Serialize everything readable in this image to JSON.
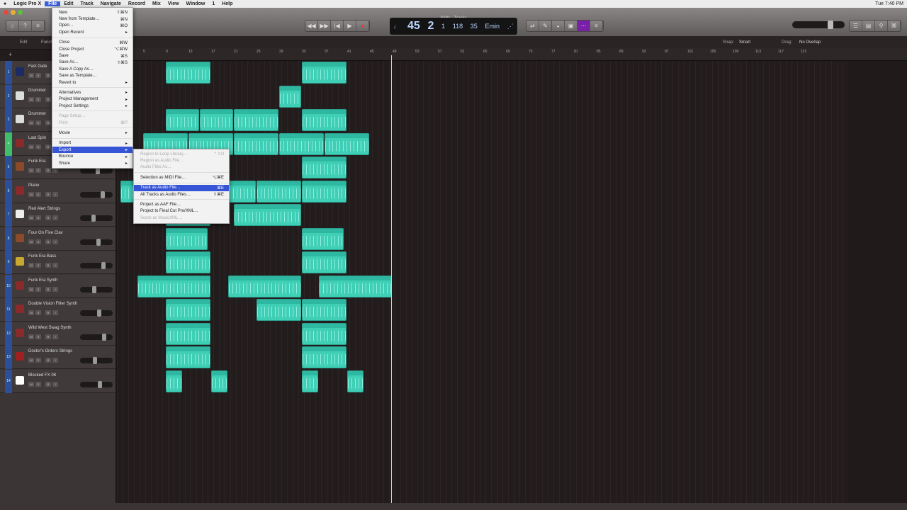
{
  "menubar": {
    "apple": "",
    "app": "Logic Pro X",
    "items": [
      "File",
      "Edit",
      "Track",
      "Navigate",
      "Record",
      "Mix",
      "View",
      "Window",
      "1",
      "Help"
    ],
    "clock": "Tue 7:40 PM"
  },
  "window": {
    "title": "Skills - Tracks"
  },
  "lcd": {
    "bar": "45",
    "beat": "2",
    "div": "1",
    "tempo": "118",
    "sig": "35",
    "key": "Emin"
  },
  "sub": {
    "edit": "Edit",
    "functions": "Functions",
    "snap_label": "Snap:",
    "snap": "Smart",
    "drag_label": "Drag:",
    "drag": "No Overlap"
  },
  "ruler": [
    "1",
    "5",
    "9",
    "13",
    "17",
    "21",
    "25",
    "29",
    "33",
    "37",
    "41",
    "45",
    "49",
    "53",
    "57",
    "61",
    "65",
    "69",
    "73",
    "77",
    "81",
    "85",
    "89",
    "93",
    "97",
    "101",
    "105",
    "109",
    "113",
    "117",
    "121"
  ],
  "tracks": [
    {
      "num": "1",
      "name": "Fast Gate",
      "color": "#1c2b66"
    },
    {
      "num": "2",
      "name": "Drummer",
      "color": "#ddd"
    },
    {
      "num": "3",
      "name": "Drummer",
      "color": "#ddd"
    },
    {
      "num": "4",
      "name": "Last Spin",
      "color": "#8b2a2a"
    },
    {
      "num": "5",
      "name": "Funk Era",
      "color": "#8b4a2a"
    },
    {
      "num": "6",
      "name": "Piano",
      "color": "#8b2a2a"
    },
    {
      "num": "7",
      "name": "Red Alert Strings",
      "color": "#eee"
    },
    {
      "num": "8",
      "name": "Four On Five Clav",
      "color": "#8b4a2a"
    },
    {
      "num": "9",
      "name": "Funk Era Bass",
      "color": "#c8a830"
    },
    {
      "num": "10",
      "name": "Funk Era Synth",
      "color": "#8b2a2a"
    },
    {
      "num": "11",
      "name": "Double Vision Filter Synth",
      "color": "#8b2a2a"
    },
    {
      "num": "12",
      "name": "Wild West Swag Synth",
      "color": "#8b2a2a"
    },
    {
      "num": "13",
      "name": "Doctor's Orders Strings",
      "color": "#a02020"
    },
    {
      "num": "14",
      "name": "Blocked FX 08",
      "color": "#fff"
    }
  ],
  "track_buttons": [
    "M",
    "S",
    "R",
    "I"
  ],
  "regions": [
    [
      [
        8,
        16
      ],
      [
        32,
        40
      ]
    ],
    [
      [
        28,
        32
      ]
    ],
    [
      [
        8,
        14
      ],
      [
        14,
        20
      ],
      [
        20,
        28
      ],
      [
        32,
        40
      ]
    ],
    [
      [
        4,
        12
      ],
      [
        12,
        20
      ],
      [
        20,
        28
      ],
      [
        28,
        36
      ],
      [
        36,
        44
      ]
    ],
    [
      [
        32,
        40
      ]
    ],
    [
      [
        0,
        8
      ],
      [
        8,
        16
      ],
      [
        16,
        24
      ],
      [
        24,
        32
      ],
      [
        32,
        40
      ]
    ],
    [
      [
        8,
        16
      ],
      [
        20,
        32
      ]
    ],
    [
      [
        8,
        15.5
      ],
      [
        32,
        39.5
      ]
    ],
    [
      [
        8,
        16
      ],
      [
        32,
        40
      ]
    ],
    [
      [
        3,
        16
      ],
      [
        19,
        32
      ],
      [
        35,
        48
      ]
    ],
    [
      [
        8,
        16
      ],
      [
        24,
        32
      ],
      [
        32,
        40
      ]
    ],
    [
      [
        8,
        16
      ],
      [
        32,
        40
      ]
    ],
    [
      [
        8,
        16
      ],
      [
        32,
        40
      ]
    ],
    [
      [
        8,
        11
      ],
      [
        16,
        19
      ],
      [
        32,
        35
      ],
      [
        40,
        43
      ]
    ]
  ],
  "playhead_bar": 48,
  "file_menu": [
    {
      "label": "New",
      "key": "⇧⌘N"
    },
    {
      "label": "New from Template…",
      "key": "⌘N"
    },
    {
      "label": "Open…",
      "key": "⌘O"
    },
    {
      "label": "Open Recent",
      "key": "▸"
    },
    {
      "sep": true
    },
    {
      "label": "Close",
      "key": "⌘W"
    },
    {
      "label": "Close Project",
      "key": "⌥⌘W"
    },
    {
      "label": "Save",
      "key": "⌘S"
    },
    {
      "label": "Save As…",
      "key": "⇧⌘S"
    },
    {
      "label": "Save A Copy As…",
      "key": ""
    },
    {
      "label": "Save as Template…",
      "key": ""
    },
    {
      "label": "Revert to",
      "key": "▸"
    },
    {
      "sep": true
    },
    {
      "label": "Alternatives",
      "key": "▸"
    },
    {
      "label": "Project Management",
      "key": "▸"
    },
    {
      "label": "Project Settings",
      "key": "▸"
    },
    {
      "sep": true
    },
    {
      "label": "Page Setup…",
      "key": "",
      "dis": true
    },
    {
      "label": "Print",
      "key": "⌘P",
      "dis": true
    },
    {
      "sep": true
    },
    {
      "label": "Movie",
      "key": "▸"
    },
    {
      "sep": true
    },
    {
      "label": "Import",
      "key": "▸"
    },
    {
      "label": "Export",
      "key": "▸",
      "hl": true
    },
    {
      "label": "Bounce",
      "key": "▸"
    },
    {
      "label": "Share",
      "key": "▸"
    }
  ],
  "export_menu": [
    {
      "label": "Region to Loop Library…",
      "key": "⌃⇧O",
      "dis": true
    },
    {
      "label": "Region as Audio File…",
      "key": "",
      "dis": true
    },
    {
      "label": "Audio Files As…",
      "key": "",
      "dis": true
    },
    {
      "sep": true
    },
    {
      "label": "Selection as MIDI File…",
      "key": "⌥⌘E"
    },
    {
      "sep": true
    },
    {
      "label": "Track as Audio File…",
      "key": "⌘E",
      "hl": true
    },
    {
      "label": "All Tracks as Audio Files…",
      "key": "⇧⌘E"
    },
    {
      "sep": true
    },
    {
      "label": "Project as AAF File…",
      "key": ""
    },
    {
      "label": "Project to Final Cut Pro/XML…",
      "key": ""
    },
    {
      "label": "Score as MusicXML…",
      "key": "",
      "dis": true
    }
  ]
}
